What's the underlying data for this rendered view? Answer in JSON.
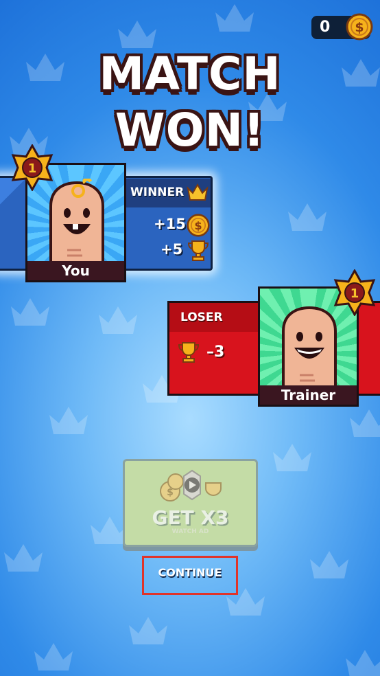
{
  "header": {
    "coins": "0"
  },
  "title": {
    "line1": "MATCH",
    "line2": "WON!"
  },
  "winner": {
    "label": "WINNER",
    "coins_reward": "+15",
    "trophy_reward": "+5",
    "name": "You",
    "rank": "1"
  },
  "loser": {
    "label": "LOSER",
    "trophy_change": "–3",
    "name": "Trainer",
    "rank": "1"
  },
  "buttons": {
    "get_x3": "GET X3",
    "watch_ad": "WATCH AD",
    "continue": "CONTINUE"
  },
  "colors": {
    "background": "#2f8ae8",
    "winner_panel": "#2b64bf",
    "loser_panel": "#d8131d",
    "gold": "#f6b21b",
    "outline": "#3a1414"
  }
}
